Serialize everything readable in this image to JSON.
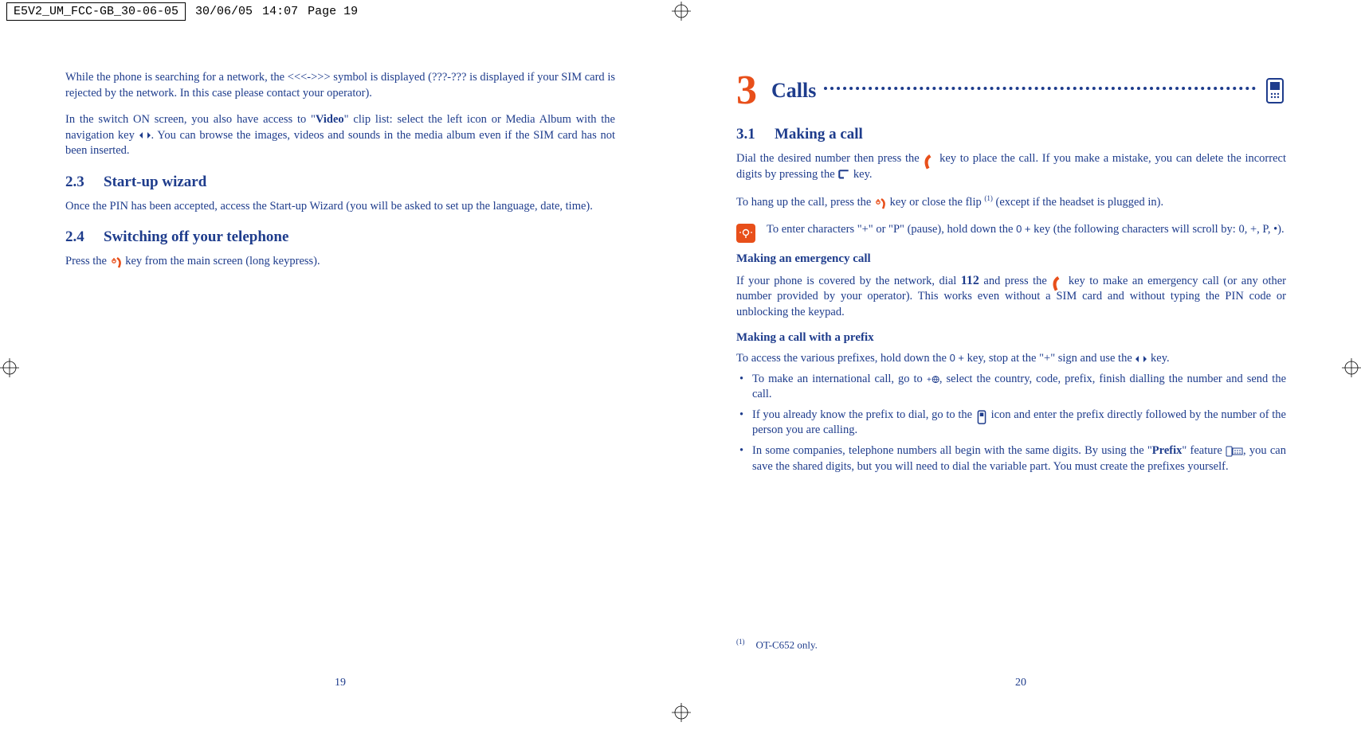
{
  "header": {
    "filename": "E5V2_UM_FCC-GB_30-06-05",
    "date": "30/06/05",
    "time": "14:07",
    "page_label": "Page 19"
  },
  "left_page": {
    "intro_para": "While the phone is searching for a network, the <<<->>> symbol is displayed (???-??? is displayed if your SIM card is rejected by the network. In this case please contact your operator).",
    "video_para_1": "In the switch ON screen, you also have access to \"",
    "video_bold": "Video",
    "video_para_2": "\" clip list: select the left icon or Media Album with the navigation key ",
    "video_para_3": ". You can browse the images, videos and sounds in the media album even if the SIM card has not been inserted.",
    "sec_2_3_num": "2.3",
    "sec_2_3_title": "Start-up wizard",
    "sec_2_3_body": "Once the PIN has been accepted, access the Start-up Wizard (you will be asked to set up the language, date, time).",
    "sec_2_4_num": "2.4",
    "sec_2_4_title": "Switching off your telephone",
    "sec_2_4_body_1": "Press the ",
    "sec_2_4_body_2": " key from the main screen (long keypress).",
    "page_number": "19"
  },
  "right_page": {
    "chapter_num": "3",
    "chapter_title": "Calls",
    "sec_3_1_num": "3.1",
    "sec_3_1_title": "Making a call",
    "dial_para_1": "Dial the desired number then press the ",
    "dial_para_2": " key to place the call. If you make a mistake, you can delete the incorrect digits by pressing the ",
    "dial_para_3": " key.",
    "hangup_1": "To hang up the call, press the ",
    "hangup_2": " key or close the flip ",
    "hangup_sup": "(1)",
    "hangup_3": " (except if the headset is plugged in).",
    "tip_1": "To enter characters \"+\" or \"P\" (pause), hold down the ",
    "tip_key": "0 +",
    "tip_2": " key (the following characters will scroll by: 0, +, P, •).",
    "emergency_head": "Making an emergency call",
    "emergency_1": "If your phone is covered by the network, dial ",
    "emergency_num": "112",
    "emergency_2": " and press the ",
    "emergency_3": " key to make an emergency call (or any other number provided by your operator). This works even without a SIM card and without typing the PIN code or unblocking the keypad.",
    "prefix_head": "Making a call with a prefix",
    "prefix_intro_1": "To access the various prefixes, hold down the ",
    "prefix_intro_key": "0 +",
    "prefix_intro_2": " key, stop at the \"+\" sign and use the ",
    "prefix_intro_3": " key.",
    "bullets": [
      {
        "pre": "To make an international call, go to ",
        "post": ", select the country, code, prefix, finish dialling the number and send the call."
      },
      {
        "pre": "If you already know the prefix to dial, go to the ",
        "post": " icon and enter the prefix directly followed by the number of the person you are calling."
      },
      {
        "pre": "In some companies, telephone numbers all begin with the same digits. By using the \"",
        "bold": "Prefix",
        "mid": "\" feature ",
        "post": ", you can save the shared digits, but you will need to dial the variable part. You must create the prefixes yourself."
      }
    ],
    "footnote_mark": "(1)",
    "footnote_text": "OT-C652 only.",
    "page_number": "20"
  }
}
